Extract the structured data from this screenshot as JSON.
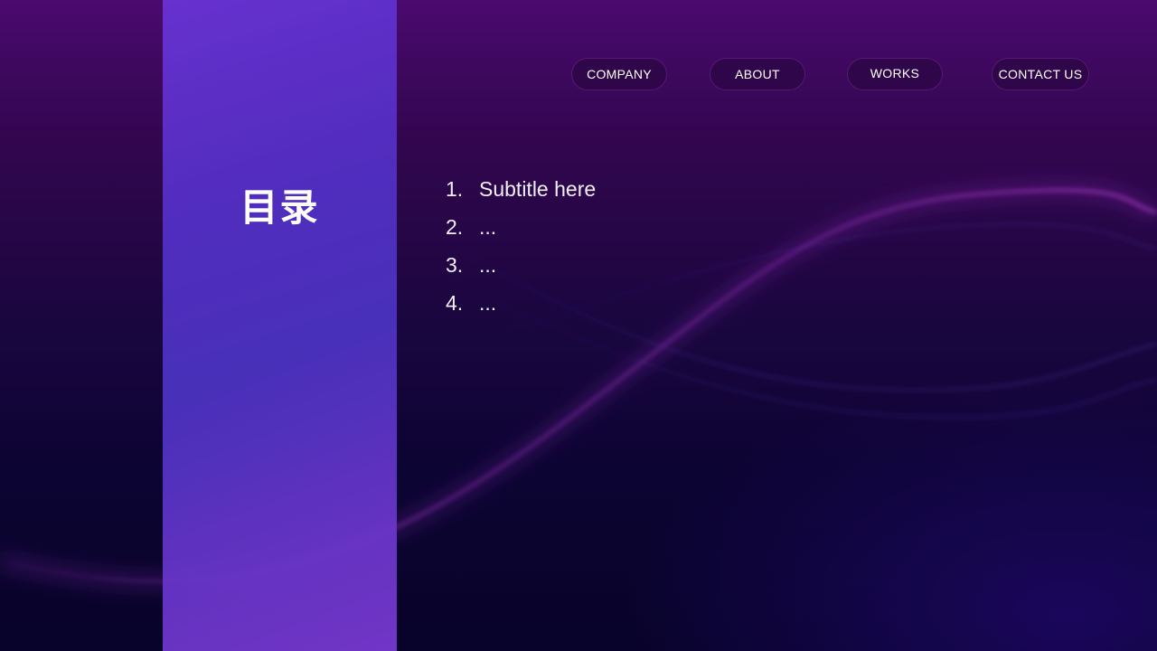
{
  "nav": {
    "items": [
      {
        "label": "COMPANY"
      },
      {
        "label": "ABOUT"
      },
      {
        "label": "WORKS"
      },
      {
        "label": "CONTACT US"
      }
    ]
  },
  "sidebar": {
    "title": "目录"
  },
  "toc": {
    "items": [
      {
        "number": "1.",
        "text": "Subtitle here"
      },
      {
        "number": "2.",
        "text": "..."
      },
      {
        "number": "3.",
        "text": "..."
      },
      {
        "number": "4.",
        "text": "..."
      }
    ]
  },
  "colors": {
    "background_top": "#4a0a6e",
    "background_bottom": "#08032a",
    "panel": "#5530c8",
    "wave_accent": "#b23ad8",
    "text": "#ffffff"
  }
}
